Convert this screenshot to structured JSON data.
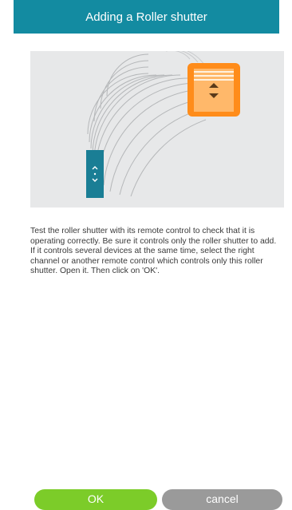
{
  "header": {
    "title": "Adding a Roller shutter"
  },
  "instructions": {
    "text": "Test the roller shutter with its remote control to check that it is operating correctly. Be sure it controls only the roller shutter to add. If it controls several devices at the same time, select the right channel or another remote control which controls only this roller shutter. Open it. Then click on 'OK'."
  },
  "buttons": {
    "ok_label": "OK",
    "cancel_label": "cancel"
  },
  "colors": {
    "header_bg": "#138ba1",
    "ok_bg": "#7ccc29",
    "cancel_bg": "#9a9a9a",
    "shutter_frame": "#ff8c1a",
    "remote": "#1a7e95",
    "illustration_bg": "#e7e8e9"
  }
}
